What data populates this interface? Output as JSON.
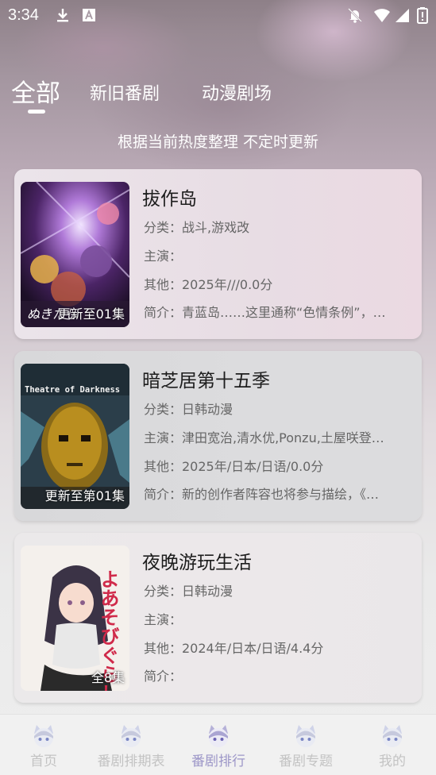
{
  "status_bar": {
    "time": "3:34",
    "left_icons": [
      "download-icon",
      "font-icon"
    ],
    "right_icons": [
      "notifications-off-icon",
      "wifi-icon",
      "signal-icon",
      "battery-icon"
    ]
  },
  "tabs": [
    {
      "label": "全部",
      "active": true
    },
    {
      "label": "新旧番剧",
      "active": false
    },
    {
      "label": "动漫剧场",
      "active": false
    }
  ],
  "subtitle": "根据当前热度整理 不定时更新",
  "cards": [
    {
      "title": "拔作岛",
      "category": "分类：战斗,游戏改",
      "cast": "主演：",
      "other": "其他：2025年///0.0分",
      "intro": "简介：青蓝岛……这里通称“色情条例”，…",
      "badge": "更新至01集",
      "poster_overlay": "ぬきたし"
    },
    {
      "title": "暗芝居第十五季",
      "category": "分类：日韩动漫",
      "cast": "主演：津田宽治,清水优,Ponzu,土屋咲登…",
      "other": "其他：2025年/日本/日语/0.0分",
      "intro": "简介：新的创作者阵容也将参与描绘，《…",
      "badge": "更新至第01集",
      "poster_overlay": "Theatre of Darkness"
    },
    {
      "title": "夜晚游玩生活",
      "category": "分类：日韩动漫",
      "cast": "主演：",
      "other": "其他：2024年/日本/日语/4.4分",
      "intro": "简介：",
      "badge": "全8集",
      "poster_overlay": "よあそびぐらし"
    }
  ],
  "bottom_nav": [
    {
      "label": "首页",
      "icon": "cat-girl-icon",
      "active": false
    },
    {
      "label": "番剧排期表",
      "icon": "cat-girl-icon",
      "active": false
    },
    {
      "label": "番剧排行",
      "icon": "cat-girl-icon",
      "active": true
    },
    {
      "label": "番剧专题",
      "icon": "cat-girl-icon",
      "active": false
    },
    {
      "label": "我的",
      "icon": "cat-girl-icon",
      "active": false
    }
  ],
  "colors": {
    "nav_active": "#9d97c8",
    "nav_inactive": "#c3c3c3"
  }
}
